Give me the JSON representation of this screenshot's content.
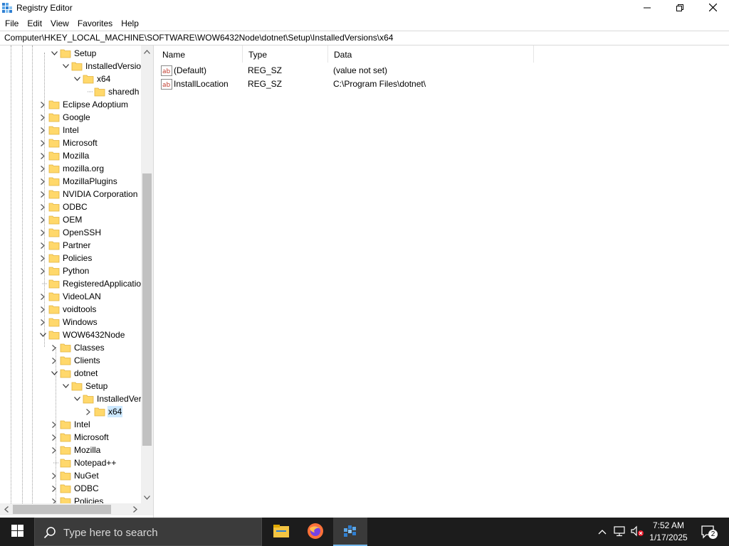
{
  "window": {
    "title": "Registry Editor",
    "controls": {
      "minimize_icon": "minimize-icon",
      "maximize_icon": "restore-icon",
      "close_icon": "close-icon"
    }
  },
  "menu": [
    "File",
    "Edit",
    "View",
    "Favorites",
    "Help"
  ],
  "address": "Computer\\HKEY_LOCAL_MACHINE\\SOFTWARE\\WOW6432Node\\dotnet\\Setup\\InstalledVersions\\x64",
  "tree": {
    "nodes": [
      {
        "label": "Setup",
        "level": 2,
        "state": "expanded"
      },
      {
        "label": "InstalledVersio",
        "level": 3,
        "state": "expanded"
      },
      {
        "label": "x64",
        "level": 4,
        "state": "expanded"
      },
      {
        "label": "sharedh",
        "level": 5,
        "state": "leaf"
      },
      {
        "label": "Eclipse Adoptium",
        "level": 1,
        "state": "collapsed"
      },
      {
        "label": "Google",
        "level": 1,
        "state": "collapsed"
      },
      {
        "label": "Intel",
        "level": 1,
        "state": "collapsed"
      },
      {
        "label": "Microsoft",
        "level": 1,
        "state": "collapsed"
      },
      {
        "label": "Mozilla",
        "level": 1,
        "state": "collapsed"
      },
      {
        "label": "mozilla.org",
        "level": 1,
        "state": "collapsed"
      },
      {
        "label": "MozillaPlugins",
        "level": 1,
        "state": "collapsed"
      },
      {
        "label": "NVIDIA Corporation",
        "level": 1,
        "state": "collapsed"
      },
      {
        "label": "ODBC",
        "level": 1,
        "state": "collapsed"
      },
      {
        "label": "OEM",
        "level": 1,
        "state": "collapsed"
      },
      {
        "label": "OpenSSH",
        "level": 1,
        "state": "collapsed"
      },
      {
        "label": "Partner",
        "level": 1,
        "state": "collapsed"
      },
      {
        "label": "Policies",
        "level": 1,
        "state": "collapsed"
      },
      {
        "label": "Python",
        "level": 1,
        "state": "collapsed"
      },
      {
        "label": "RegisteredApplicatio",
        "level": 1,
        "state": "leaf"
      },
      {
        "label": "VideoLAN",
        "level": 1,
        "state": "collapsed"
      },
      {
        "label": "voidtools",
        "level": 1,
        "state": "collapsed"
      },
      {
        "label": "Windows",
        "level": 1,
        "state": "collapsed"
      },
      {
        "label": "WOW6432Node",
        "level": 1,
        "state": "expanded"
      },
      {
        "label": "Classes",
        "level": 2,
        "state": "collapsed"
      },
      {
        "label": "Clients",
        "level": 2,
        "state": "collapsed"
      },
      {
        "label": "dotnet",
        "level": 2,
        "state": "expanded"
      },
      {
        "label": "Setup",
        "level": 3,
        "state": "expanded"
      },
      {
        "label": "InstalledVer",
        "level": 4,
        "state": "expanded"
      },
      {
        "label": "x64",
        "level": 5,
        "state": "collapsed",
        "selected": true
      },
      {
        "label": "Intel",
        "level": 2,
        "state": "collapsed"
      },
      {
        "label": "Microsoft",
        "level": 2,
        "state": "collapsed"
      },
      {
        "label": "Mozilla",
        "level": 2,
        "state": "collapsed"
      },
      {
        "label": "Notepad++",
        "level": 2,
        "state": "leaf"
      },
      {
        "label": "NuGet",
        "level": 2,
        "state": "collapsed"
      },
      {
        "label": "ODBC",
        "level": 2,
        "state": "collapsed"
      },
      {
        "label": "Policies",
        "level": 2,
        "state": "collapsed"
      }
    ]
  },
  "list": {
    "columns": [
      "Name",
      "Type",
      "Data"
    ],
    "rows": [
      {
        "icon": "reg-sz-icon",
        "name": "(Default)",
        "type": "REG_SZ",
        "data": "(value not set)"
      },
      {
        "icon": "reg-sz-icon",
        "name": "InstallLocation",
        "type": "REG_SZ",
        "data": "C:\\Program Files\\dotnet\\"
      }
    ]
  },
  "taskbar": {
    "search_placeholder": "Type here to search",
    "apps": [
      "file-explorer-icon",
      "firefox-icon",
      "registry-editor-icon"
    ],
    "time": "7:52 AM",
    "date": "1/17/2025",
    "notification_count": "2",
    "colors": {
      "taskbar": "#1c1c1c",
      "search": "#3b3b3b",
      "active_underline": "#76b9ed",
      "selection": "#cce8ff",
      "folder": "#ffd86b"
    }
  }
}
